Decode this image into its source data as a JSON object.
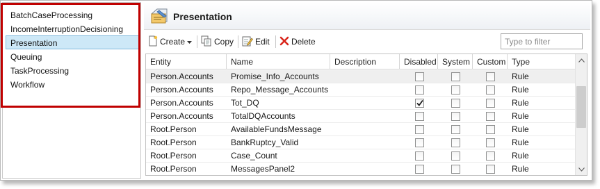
{
  "nav": {
    "items": [
      {
        "label": "BatchCaseProcessing",
        "selected": false
      },
      {
        "label": "IncomeInterruptionDecisioning",
        "selected": false
      },
      {
        "label": "Presentation",
        "selected": true
      },
      {
        "label": "Queuing",
        "selected": false
      },
      {
        "label": "TaskProcessing",
        "selected": false
      },
      {
        "label": "Workflow",
        "selected": false
      }
    ]
  },
  "header": {
    "title": "Presentation",
    "icon": "presentation-folder-icon"
  },
  "toolbar": {
    "create_label": "Create",
    "copy_label": "Copy",
    "edit_label": "Edit",
    "delete_label": "Delete",
    "filter_placeholder": "Type to filter",
    "filter_value": ""
  },
  "grid": {
    "columns": [
      "Entity",
      "Name",
      "Description",
      "Disabled",
      "System",
      "Custom",
      "Type"
    ],
    "rows": [
      {
        "entity": "Person.Accounts",
        "name": "Promise_Info_Accounts",
        "description": "",
        "disabled": false,
        "system": false,
        "custom": false,
        "type": "Rule"
      },
      {
        "entity": "Person.Accounts",
        "name": "Repo_Message_Accounts",
        "description": "",
        "disabled": false,
        "system": false,
        "custom": false,
        "type": "Rule"
      },
      {
        "entity": "Person.Accounts",
        "name": "Tot_DQ",
        "description": "",
        "disabled": true,
        "system": false,
        "custom": false,
        "type": "Rule"
      },
      {
        "entity": "Person.Accounts",
        "name": "TotalDQAccounts",
        "description": "",
        "disabled": false,
        "system": false,
        "custom": false,
        "type": "Rule"
      },
      {
        "entity": "Root.Person",
        "name": "AvailableFundsMessage",
        "description": "",
        "disabled": false,
        "system": false,
        "custom": false,
        "type": "Rule"
      },
      {
        "entity": "Root.Person",
        "name": "BankRuptcy_Valid",
        "description": "",
        "disabled": false,
        "system": false,
        "custom": false,
        "type": "Rule"
      },
      {
        "entity": "Root.Person",
        "name": "Case_Count",
        "description": "",
        "disabled": false,
        "system": false,
        "custom": false,
        "type": "Rule"
      },
      {
        "entity": "Root.Person",
        "name": "MessagesPanel2",
        "description": "",
        "disabled": false,
        "system": false,
        "custom": false,
        "type": "Rule"
      }
    ]
  },
  "colors": {
    "highlight_border": "#c00000",
    "selected_bg": "#cde8f7",
    "delete_icon": "#d9261c"
  }
}
